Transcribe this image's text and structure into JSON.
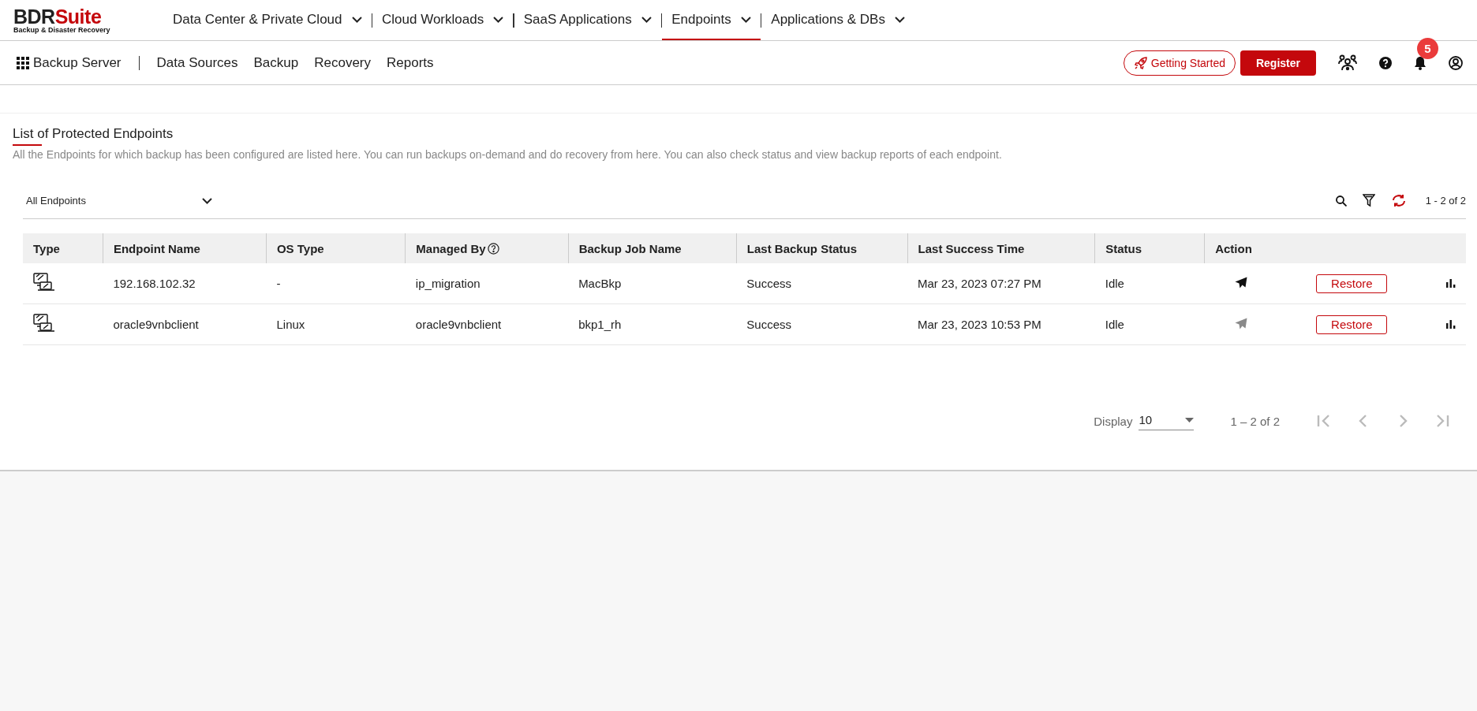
{
  "brand": {
    "name_main": "BDR",
    "name_accent": "Suite",
    "tagline": "Backup & Disaster Recovery"
  },
  "top_nav": [
    {
      "label": "Data Center & Private Cloud",
      "selected": false
    },
    {
      "label": "Cloud Workloads",
      "selected": false
    },
    {
      "label": "SaaS Applications",
      "selected": false
    },
    {
      "label": "Endpoints",
      "selected": true
    },
    {
      "label": "Applications & DBs",
      "selected": false
    }
  ],
  "sub_nav": {
    "product": "Backup Server",
    "items": [
      "Data Sources",
      "Backup",
      "Recovery",
      "Reports"
    ]
  },
  "header_actions": {
    "getting_started": "Getting Started",
    "register": "Register",
    "notification_count": "5"
  },
  "page": {
    "title": "List of Protected Endpoints",
    "description": "All the Endpoints for which backup has been configured are listed here. You can run backups on-demand and do recovery from here. You can also check status and view backup reports of each endpoint."
  },
  "filter": {
    "value": "All Endpoints"
  },
  "toolbar": {
    "range": "1 - 2 of 2"
  },
  "table": {
    "columns": [
      {
        "label": "Type",
        "help": false
      },
      {
        "label": "Endpoint Name",
        "help": false
      },
      {
        "label": "OS Type",
        "help": false
      },
      {
        "label": "Managed By",
        "help": true
      },
      {
        "label": "Backup Job Name",
        "help": false
      },
      {
        "label": "Last Backup Status",
        "help": false
      },
      {
        "label": "Last Success Time",
        "help": false
      },
      {
        "label": "Status",
        "help": false
      },
      {
        "label": "Action",
        "help": false
      }
    ],
    "rows": [
      {
        "endpoint_name": "192.168.102.32",
        "os_type": "-",
        "managed_by": "ip_migration",
        "backup_job_name": "MacBkp",
        "last_backup_status": "Success",
        "last_success_time": "Mar 23, 2023 07:27 PM",
        "status": "Idle",
        "backup_now_enabled": true,
        "restore": "Restore"
      },
      {
        "endpoint_name": "oracle9vnbclient",
        "os_type": "Linux",
        "managed_by": "oracle9vnbclient",
        "backup_job_name": "bkp1_rh",
        "last_backup_status": "Success",
        "last_success_time": "Mar 23, 2023 10:53 PM",
        "status": "Idle",
        "backup_now_enabled": false,
        "restore": "Restore"
      }
    ]
  },
  "pagination": {
    "label": "Display",
    "page_size": "10",
    "range": "1 – 2 of 2"
  }
}
